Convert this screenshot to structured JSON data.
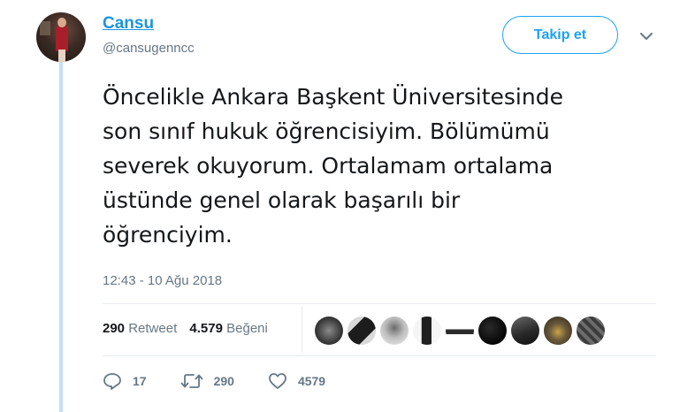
{
  "author": {
    "display_name": "Cansu",
    "handle": "@cansugenncc"
  },
  "follow_button": {
    "label": "Takip et"
  },
  "tweet": {
    "lines": [
      "Öncelikle Ankara Başkent Üniversitesinde",
      "son sınıf hukuk öğrencisiyim. Bölümümü",
      "severek okuyorum. Ortalamam ortalama",
      "üstünde genel olarak başarılı bir",
      "öğrenciyim."
    ],
    "timestamp": "12:43 - 10 Ağu 2018"
  },
  "stats": {
    "retweet_count": "290",
    "retweet_label": "Retweet",
    "like_count": "4.579",
    "like_label": "Beğeni"
  },
  "actions": {
    "reply_count": "17",
    "retweet_count": "290",
    "like_count": "4579"
  },
  "colors": {
    "accent": "#1da1f2",
    "name_link": "#1b95e0",
    "secondary_text": "#657786",
    "thread_line": "#c4e0f5"
  },
  "likers": [
    {
      "icon": "liker-avatar-1"
    },
    {
      "icon": "liker-avatar-2"
    },
    {
      "icon": "liker-avatar-3"
    },
    {
      "icon": "liker-avatar-4"
    },
    {
      "icon": "liker-avatar-5"
    },
    {
      "icon": "liker-avatar-6"
    },
    {
      "icon": "liker-avatar-7"
    },
    {
      "icon": "liker-avatar-8"
    },
    {
      "icon": "liker-avatar-9"
    }
  ]
}
